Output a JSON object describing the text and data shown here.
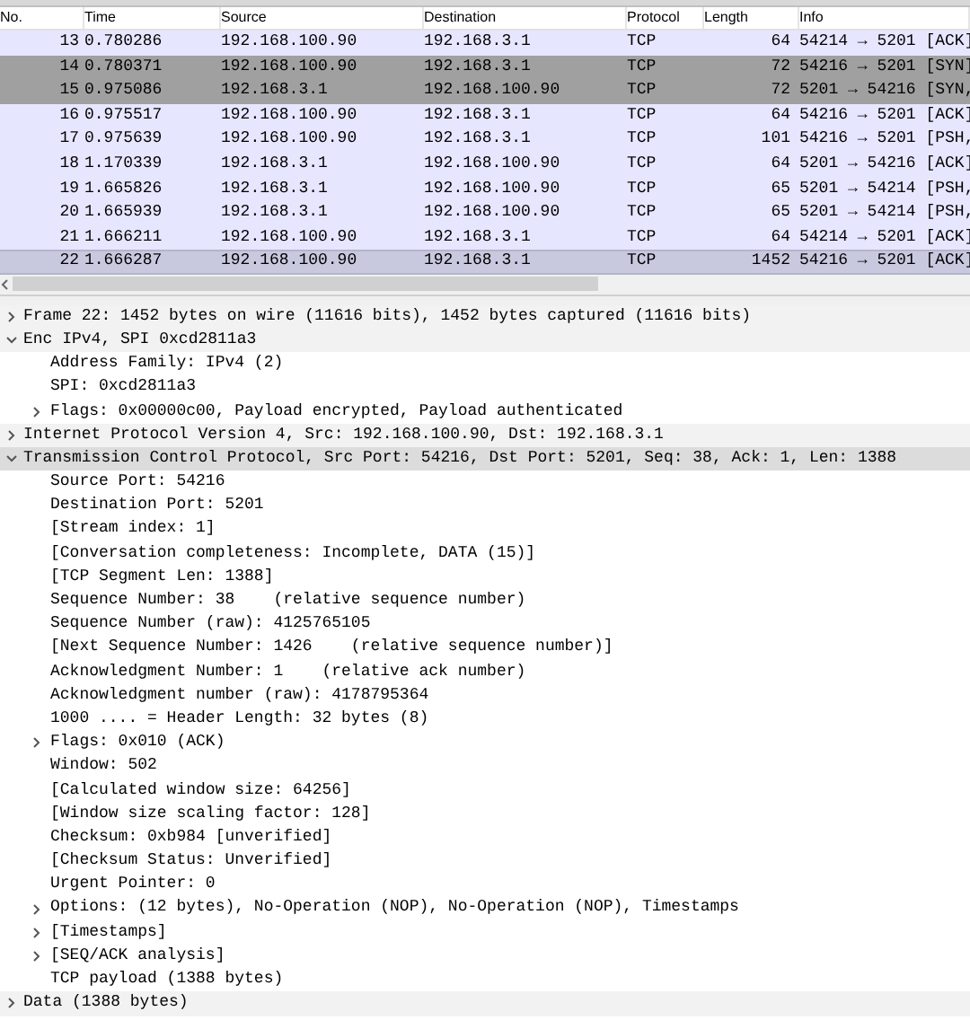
{
  "packet_list": {
    "columns": [
      "No.",
      "Time",
      "Source",
      "Destination",
      "Protocol",
      "Length",
      "Info"
    ],
    "rows": [
      {
        "no": "13",
        "time": "0.780286",
        "source": "192.168.100.90",
        "destination": "192.168.3.1",
        "protocol": "TCP",
        "length": "64",
        "info": "54214 → 5201 [ACK]",
        "color": "#e7e6ff",
        "selected": false
      },
      {
        "no": "14",
        "time": "0.780371",
        "source": "192.168.100.90",
        "destination": "192.168.3.1",
        "protocol": "TCP",
        "length": "72",
        "info": "54216 → 5201 [SYN]",
        "color": "#a0a0a0",
        "selected": false
      },
      {
        "no": "15",
        "time": "0.975086",
        "source": "192.168.3.1",
        "destination": "192.168.100.90",
        "protocol": "TCP",
        "length": "72",
        "info": "5201 → 54216 [SYN,",
        "color": "#a0a0a0",
        "selected": false
      },
      {
        "no": "16",
        "time": "0.975517",
        "source": "192.168.100.90",
        "destination": "192.168.3.1",
        "protocol": "TCP",
        "length": "64",
        "info": "54216 → 5201 [ACK]",
        "color": "#e7e6ff",
        "selected": false
      },
      {
        "no": "17",
        "time": "0.975639",
        "source": "192.168.100.90",
        "destination": "192.168.3.1",
        "protocol": "TCP",
        "length": "101",
        "info": "54216 → 5201 [PSH,",
        "color": "#e7e6ff",
        "selected": false
      },
      {
        "no": "18",
        "time": "1.170339",
        "source": "192.168.3.1",
        "destination": "192.168.100.90",
        "protocol": "TCP",
        "length": "64",
        "info": "5201 → 54216 [ACK]",
        "color": "#e7e6ff",
        "selected": false
      },
      {
        "no": "19",
        "time": "1.665826",
        "source": "192.168.3.1",
        "destination": "192.168.100.90",
        "protocol": "TCP",
        "length": "65",
        "info": "5201 → 54214 [PSH,",
        "color": "#e7e6ff",
        "selected": false
      },
      {
        "no": "20",
        "time": "1.665939",
        "source": "192.168.3.1",
        "destination": "192.168.100.90",
        "protocol": "TCP",
        "length": "65",
        "info": "5201 → 54214 [PSH,",
        "color": "#e7e6ff",
        "selected": false
      },
      {
        "no": "21",
        "time": "1.666211",
        "source": "192.168.100.90",
        "destination": "192.168.3.1",
        "protocol": "TCP",
        "length": "64",
        "info": "54214 → 5201 [ACK]",
        "color": "#e7e6ff",
        "selected": false
      },
      {
        "no": "22",
        "time": "1.666287",
        "source": "192.168.100.90",
        "destination": "192.168.3.1",
        "protocol": "TCP",
        "length": "1452",
        "info": "54216 → 5201 [ACK]",
        "color": "#c8c8df",
        "selected": true
      }
    ]
  },
  "details": [
    {
      "text": "Frame 22: 1452 bytes on wire (11616 bits), 1452 bytes captured (11616 bits)",
      "expanded": false,
      "selected": false
    },
    {
      "text": "Enc IPv4, SPI 0xcd2811a3",
      "expanded": true,
      "selected": false,
      "children": [
        {
          "text": "Address Family: IPv4 (2)",
          "selected": false
        },
        {
          "text": "SPI: 0xcd2811a3",
          "selected": false
        },
        {
          "text": "Flags: 0x00000c00, Payload encrypted, Payload authenticated",
          "expanded": false,
          "selected": false
        }
      ]
    },
    {
      "text": "Internet Protocol Version 4, Src: 192.168.100.90, Dst: 192.168.3.1",
      "expanded": false,
      "selected": false
    },
    {
      "text": "Transmission Control Protocol, Src Port: 54216, Dst Port: 5201, Seq: 38, Ack: 1, Len: 1388",
      "expanded": true,
      "selected": true,
      "children": [
        {
          "text": "Source Port: 54216",
          "selected": false
        },
        {
          "text": "Destination Port: 5201",
          "selected": false
        },
        {
          "text": "[Stream index: 1]",
          "selected": false
        },
        {
          "text": "[Conversation completeness: Incomplete, DATA (15)]",
          "selected": false
        },
        {
          "text": "[TCP Segment Len: 1388]",
          "selected": false
        },
        {
          "text": "Sequence Number: 38    (relative sequence number)",
          "selected": false
        },
        {
          "text": "Sequence Number (raw): 4125765105",
          "selected": false
        },
        {
          "text": "[Next Sequence Number: 1426    (relative sequence number)]",
          "selected": false
        },
        {
          "text": "Acknowledgment Number: 1    (relative ack number)",
          "selected": false
        },
        {
          "text": "Acknowledgment number (raw): 4178795364",
          "selected": false
        },
        {
          "text": "1000 .... = Header Length: 32 bytes (8)",
          "selected": false
        },
        {
          "text": "Flags: 0x010 (ACK)",
          "expanded": false,
          "selected": false
        },
        {
          "text": "Window: 502",
          "selected": false
        },
        {
          "text": "[Calculated window size: 64256]",
          "selected": false
        },
        {
          "text": "[Window size scaling factor: 128]",
          "selected": false
        },
        {
          "text": "Checksum: 0xb984 [unverified]",
          "selected": false
        },
        {
          "text": "[Checksum Status: Unverified]",
          "selected": false
        },
        {
          "text": "Urgent Pointer: 0",
          "selected": false
        },
        {
          "text": "Options: (12 bytes), No-Operation (NOP), No-Operation (NOP), Timestamps",
          "expanded": false,
          "selected": false
        },
        {
          "text": "[Timestamps]",
          "expanded": false,
          "selected": false
        },
        {
          "text": "[SEQ/ACK analysis]",
          "expanded": false,
          "selected": false
        },
        {
          "text": "TCP payload (1388 bytes)",
          "selected": false
        }
      ]
    },
    {
      "text": "Data (1388 bytes)",
      "expanded": false,
      "selected": false
    }
  ]
}
